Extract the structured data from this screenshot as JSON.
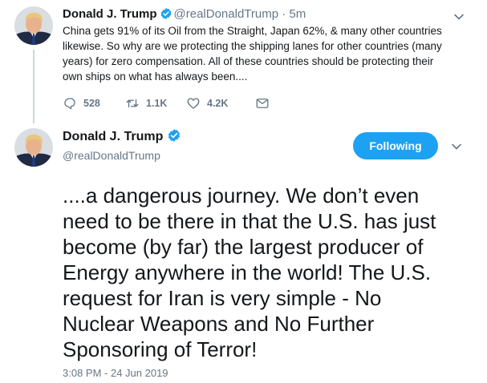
{
  "tweet1": {
    "name": "Donald J. Trump",
    "handle": "@realDonaldTrump",
    "time": "· 5m",
    "text_lines": [
      "China gets 91% of its Oil from the Straight, Japan 62%, & many other countries",
      "likewise. So why are we protecting the shipping lanes for other countries (many",
      "years) for zero compensation. All of these countries should be protecting their",
      "own ships on what has always been...."
    ],
    "actions": {
      "replies": "528",
      "retweets": "1.1K",
      "likes": "4.2K"
    }
  },
  "tweet2": {
    "name": "Donald J. Trump",
    "handle": "@realDonaldTrump",
    "follow_label": "Following",
    "text_lines": [
      "....a dangerous journey. We don’t even",
      "need to be there in that the U.S. has just",
      "become (by far) the largest producer of",
      "Energy anywhere in the world! The U.S.",
      "request for Iran is very simple - No",
      "Nuclear Weapons and No Further",
      "Sponsoring of Terror!"
    ],
    "timestamp": "3:08 PM - 24 Jun 2019"
  },
  "icons": [
    "verified-badge-icon",
    "chevron-down-icon",
    "reply-icon",
    "retweet-icon",
    "like-icon",
    "direct-message-icon"
  ],
  "colors": {
    "accent": "#1da1f2",
    "text": "#14171a",
    "muted": "#657786",
    "thread_line": "#ccd6dd"
  }
}
